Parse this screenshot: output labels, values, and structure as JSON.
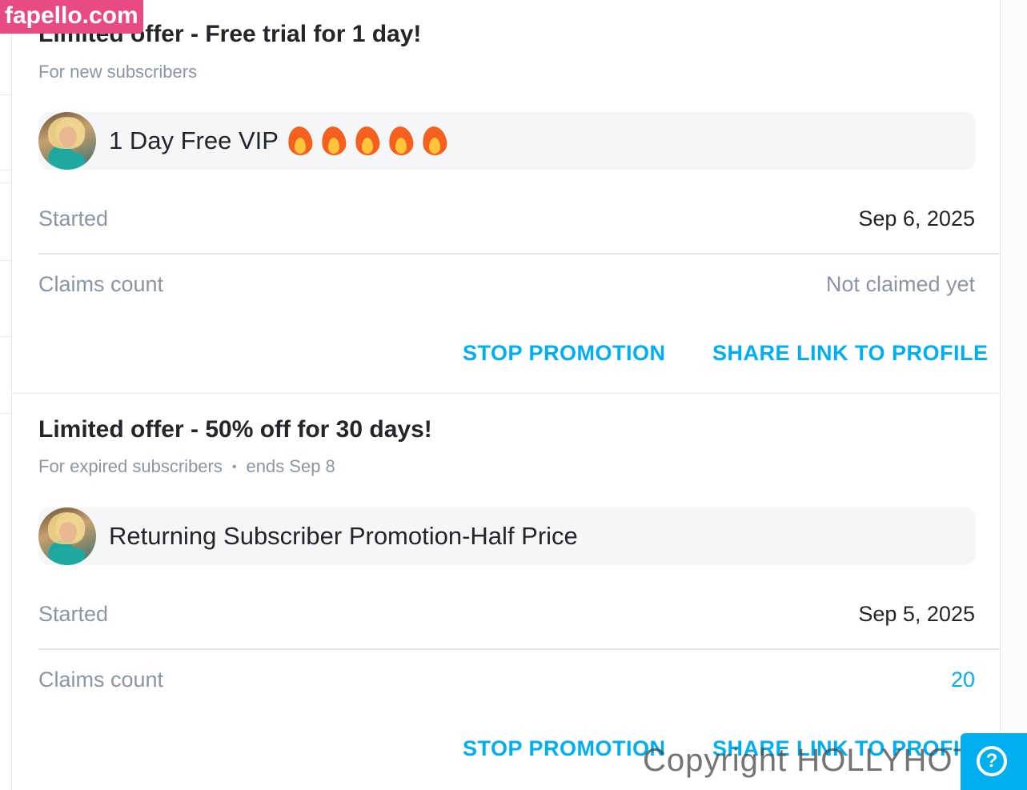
{
  "watermark": {
    "site": "fapello.com",
    "copyright": "Copyright HOLLYHOTWIFE"
  },
  "offers": [
    {
      "title": "Limited offer - Free trial for 1 day!",
      "audience": "For new subscribers",
      "ends": "",
      "promo_name": "1 Day Free VIP",
      "promo_emoji": "fire-icon x5",
      "started_label": "Started",
      "started_value": "Sep 6, 2025",
      "claims_label": "Claims count",
      "claims_value": "Not claimed yet",
      "stop_label": "STOP PROMOTION",
      "share_label": "SHARE LINK TO PROFILE"
    },
    {
      "title": "Limited offer - 50% off for 30 days!",
      "audience": "For expired subscribers",
      "ends": "ends Sep 8",
      "promo_name": "Returning Subscriber Promotion-Half Price",
      "started_label": "Started",
      "started_value": "Sep 5, 2025",
      "claims_label": "Claims count",
      "claims_value": "20",
      "stop_label": "STOP PROMOTION",
      "share_label": "SHARE LINK TO PROFILE"
    }
  ],
  "colors": {
    "accent": "#00aff0",
    "text_primary": "#242529",
    "text_muted": "#8a96a3",
    "pill_bg": "#f4f6f7",
    "divider": "#e3e7ea",
    "watermark_pink": "#e84a83"
  },
  "icons": {
    "help": "help-chat-icon",
    "avatar": "creator-avatar"
  }
}
